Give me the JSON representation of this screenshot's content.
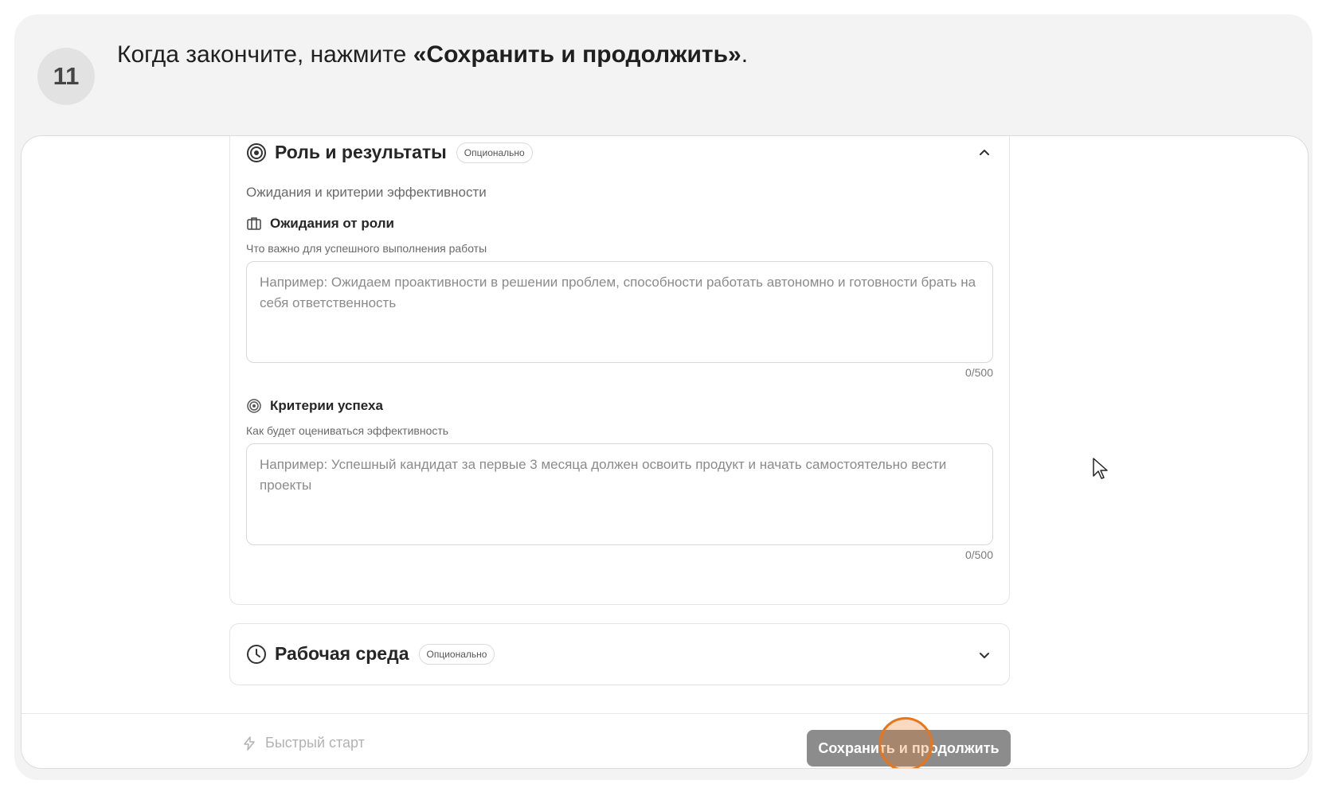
{
  "step": {
    "number": "11",
    "text_before": "Когда закончите, нажмите ",
    "text_bold": "«Сохранить и продолжить»",
    "text_after": "."
  },
  "role_section": {
    "title": "Роль и результаты",
    "badge": "Опционально",
    "subtitle": "Ожидания и критерии эффективности",
    "expectations": {
      "label": "Ожидания от роли",
      "hint": "Что важно для успешного выполнения работы",
      "placeholder": "Например: Ожидаем проактивности в решении проблем, способности работать автономно и готовности брать на себя ответственность",
      "counter": "0/500"
    },
    "success": {
      "label": "Критерии успеха",
      "hint": "Как будет оцениваться эффективность",
      "placeholder": "Например: Успешный кандидат за первые 3 месяца должен освоить продукт и начать самостоятельно вести проекты",
      "counter": "0/500"
    }
  },
  "env_section": {
    "title": "Рабочая среда",
    "badge": "Опционально"
  },
  "footer": {
    "quick_start": "Быстрый старт",
    "save_button": "Сохранить и продолжить"
  },
  "colors": {
    "button_bg": "#8c8c8c",
    "click_highlight": "#e8751a"
  },
  "icons": [
    "target-icon",
    "briefcase-icon",
    "clock-icon",
    "chevron-up-icon",
    "chevron-down-icon",
    "lightning-icon",
    "mouse-cursor-icon"
  ]
}
